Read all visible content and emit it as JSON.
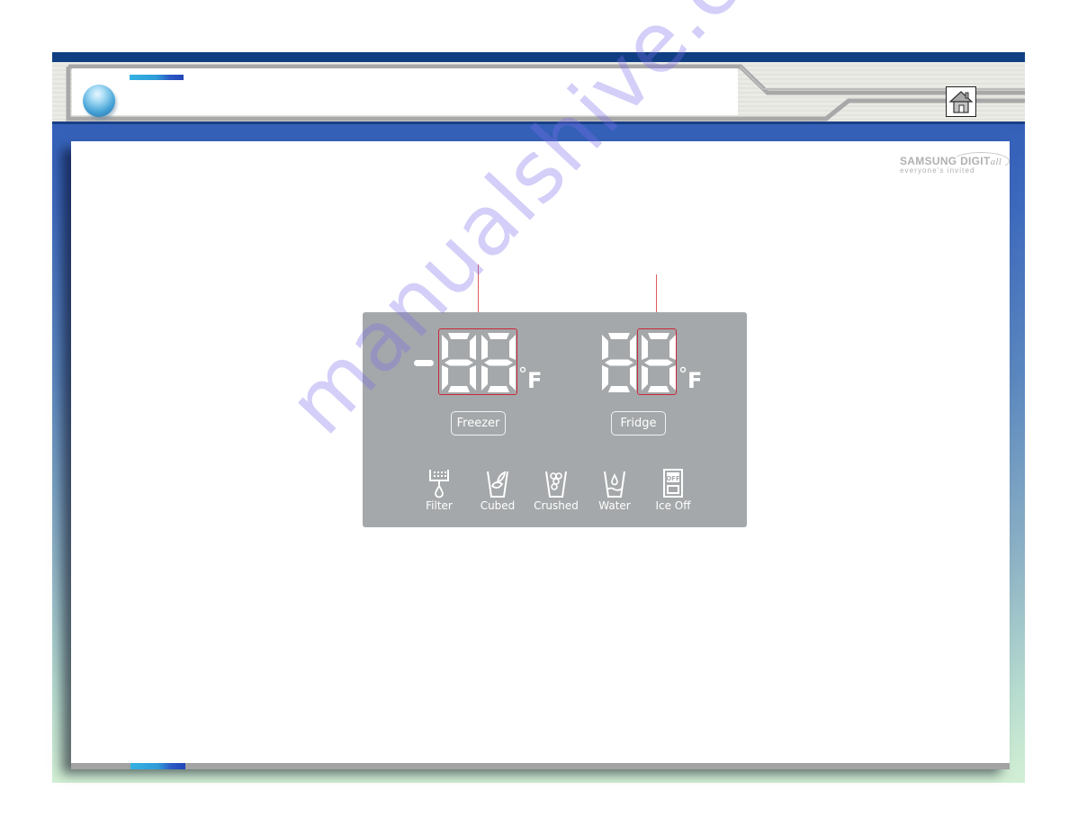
{
  "header": {
    "home_icon": "home-icon",
    "orb_icon": "blue-orb-bullet-icon"
  },
  "logo": {
    "brand": "SAMSUNG DIGIT",
    "brand_suffix": "all",
    "tagline": "everyone's invited"
  },
  "panel": {
    "freezer": {
      "sign": "-",
      "digits": [
        "8",
        "8"
      ],
      "unit_degree": "°",
      "unit_letter": "F",
      "button_label": "Freezer",
      "highlighted": "both digits"
    },
    "fridge": {
      "digits": [
        "8",
        "8"
      ],
      "unit_degree": "°",
      "unit_letter": "F",
      "button_label": "Fridge",
      "highlighted": "second digit"
    },
    "functions": [
      {
        "label": "Filter",
        "icon": "filter-icon"
      },
      {
        "label": "Cubed",
        "icon": "cubed-ice-icon"
      },
      {
        "label": "Crushed",
        "icon": "crushed-ice-icon"
      },
      {
        "label": "Water",
        "icon": "water-icon"
      },
      {
        "label": "Ice Off",
        "icon": "ice-off-icon"
      }
    ],
    "ice_off_badge": "OFF"
  },
  "colors": {
    "panel_gray": "#a5a8aa",
    "highlight_red": "#c8283a",
    "arrow_red": "#e0222a",
    "frame_blue": "#2c58b4",
    "header_navy": "#0f3f82"
  },
  "watermark": "manualshive.com"
}
